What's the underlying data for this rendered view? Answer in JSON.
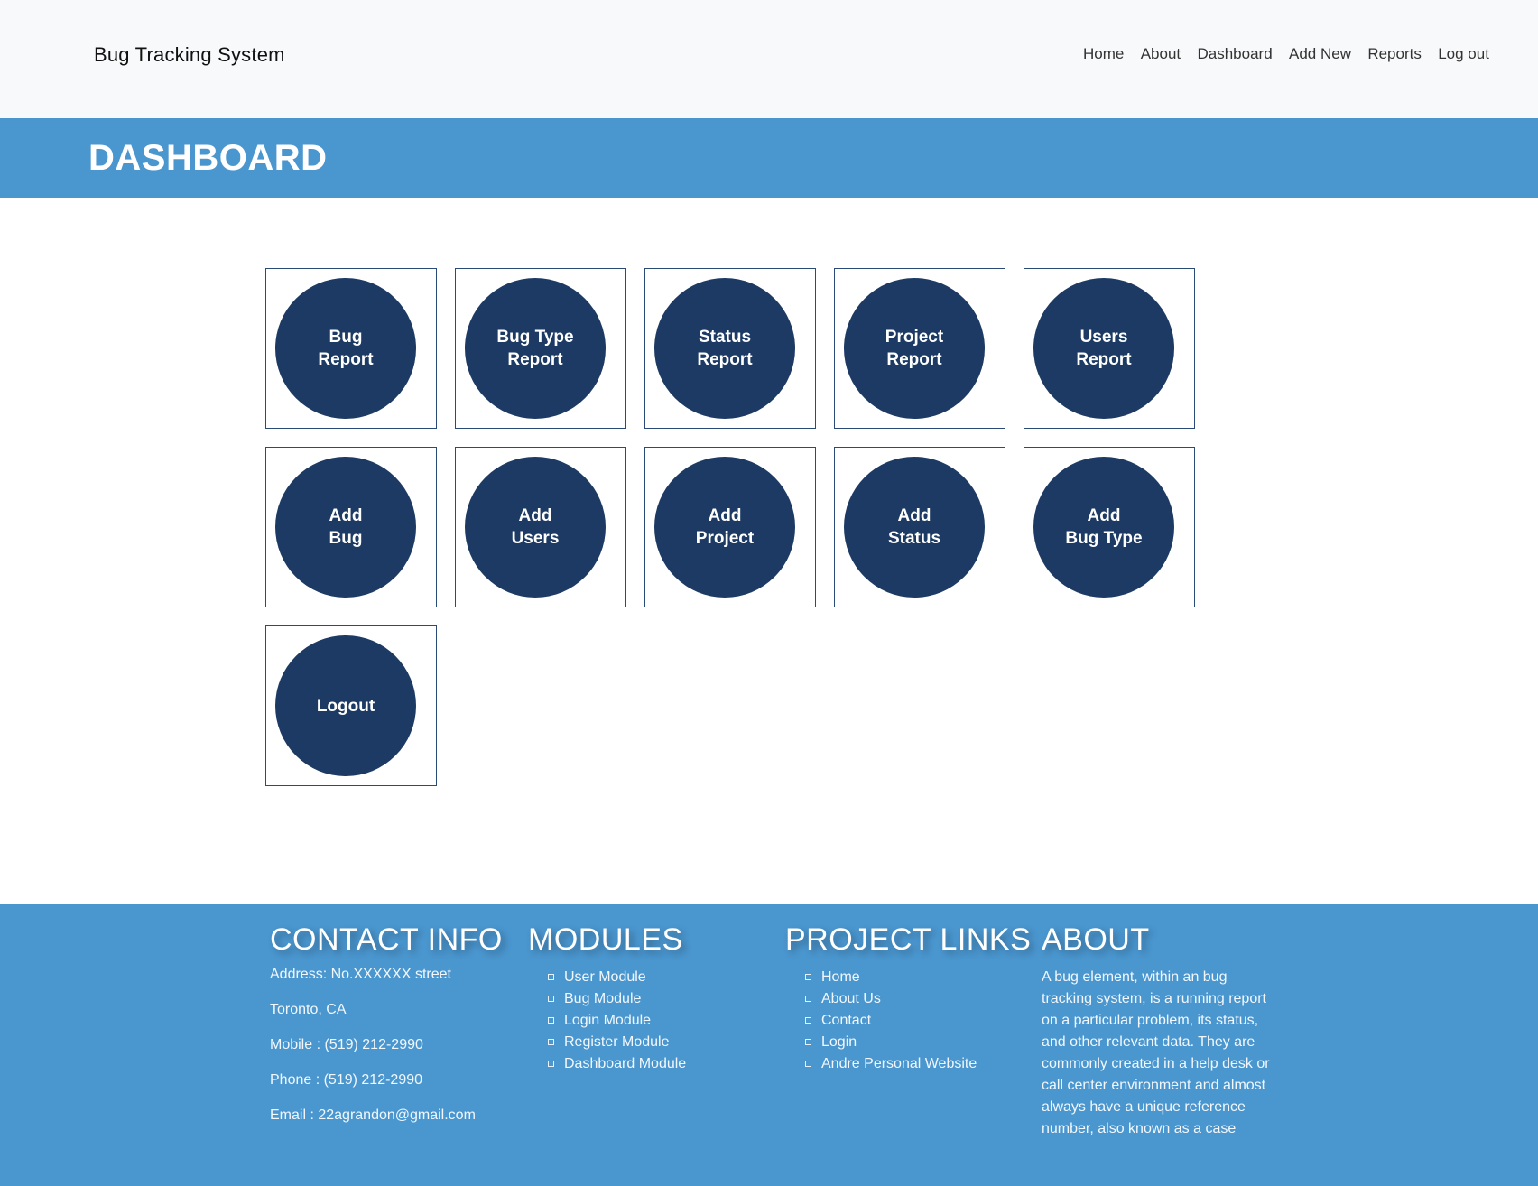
{
  "navbar": {
    "brand": "Bug Tracking System",
    "links": [
      "Home",
      "About",
      "Dashboard",
      "Add New",
      "Reports",
      "Log out"
    ]
  },
  "header": {
    "title": "DASHBOARD"
  },
  "tiles": {
    "bug_report": "Bug\nReport",
    "bug_type_report": "Bug Type\nReport",
    "status_report": "Status\nReport",
    "project_report": "Project\nReport",
    "users_report": "Users\nReport",
    "add_bug": "Add\nBug",
    "add_users": "Add\nUsers",
    "add_project": "Add\nProject",
    "add_status": "Add\nStatus",
    "add_bug_type": "Add\nBug Type",
    "logout": "Logout"
  },
  "colors": {
    "accent_blue": "#4a96cf",
    "tile_navy": "#1c3a63",
    "navbar_bg": "#f8f9fa"
  },
  "footer": {
    "contact": {
      "heading": "CONTACT INFO",
      "address": "Address: No.XXXXXX street",
      "city": "Toronto, CA",
      "mobile": "Mobile : (519) 212-2990",
      "phone": "Phone : (519) 212-2990",
      "email": "Email : 22agrandon@gmail.com"
    },
    "modules": {
      "heading": "MODULES",
      "items": [
        "User Module",
        "Bug Module",
        "Login Module",
        "Register Module",
        "Dashboard Module"
      ]
    },
    "project_links": {
      "heading": "PROJECT LINKS",
      "items": [
        "Home",
        "About Us",
        "Contact",
        "Login",
        "Andre Personal Website"
      ]
    },
    "about": {
      "heading": "ABOUT",
      "text": "A bug element, within an bug tracking system, is a running report on a particular problem, its status, and other relevant data. They are commonly created in a help desk or call center environment and almost always have a unique reference number, also known as a case"
    }
  }
}
